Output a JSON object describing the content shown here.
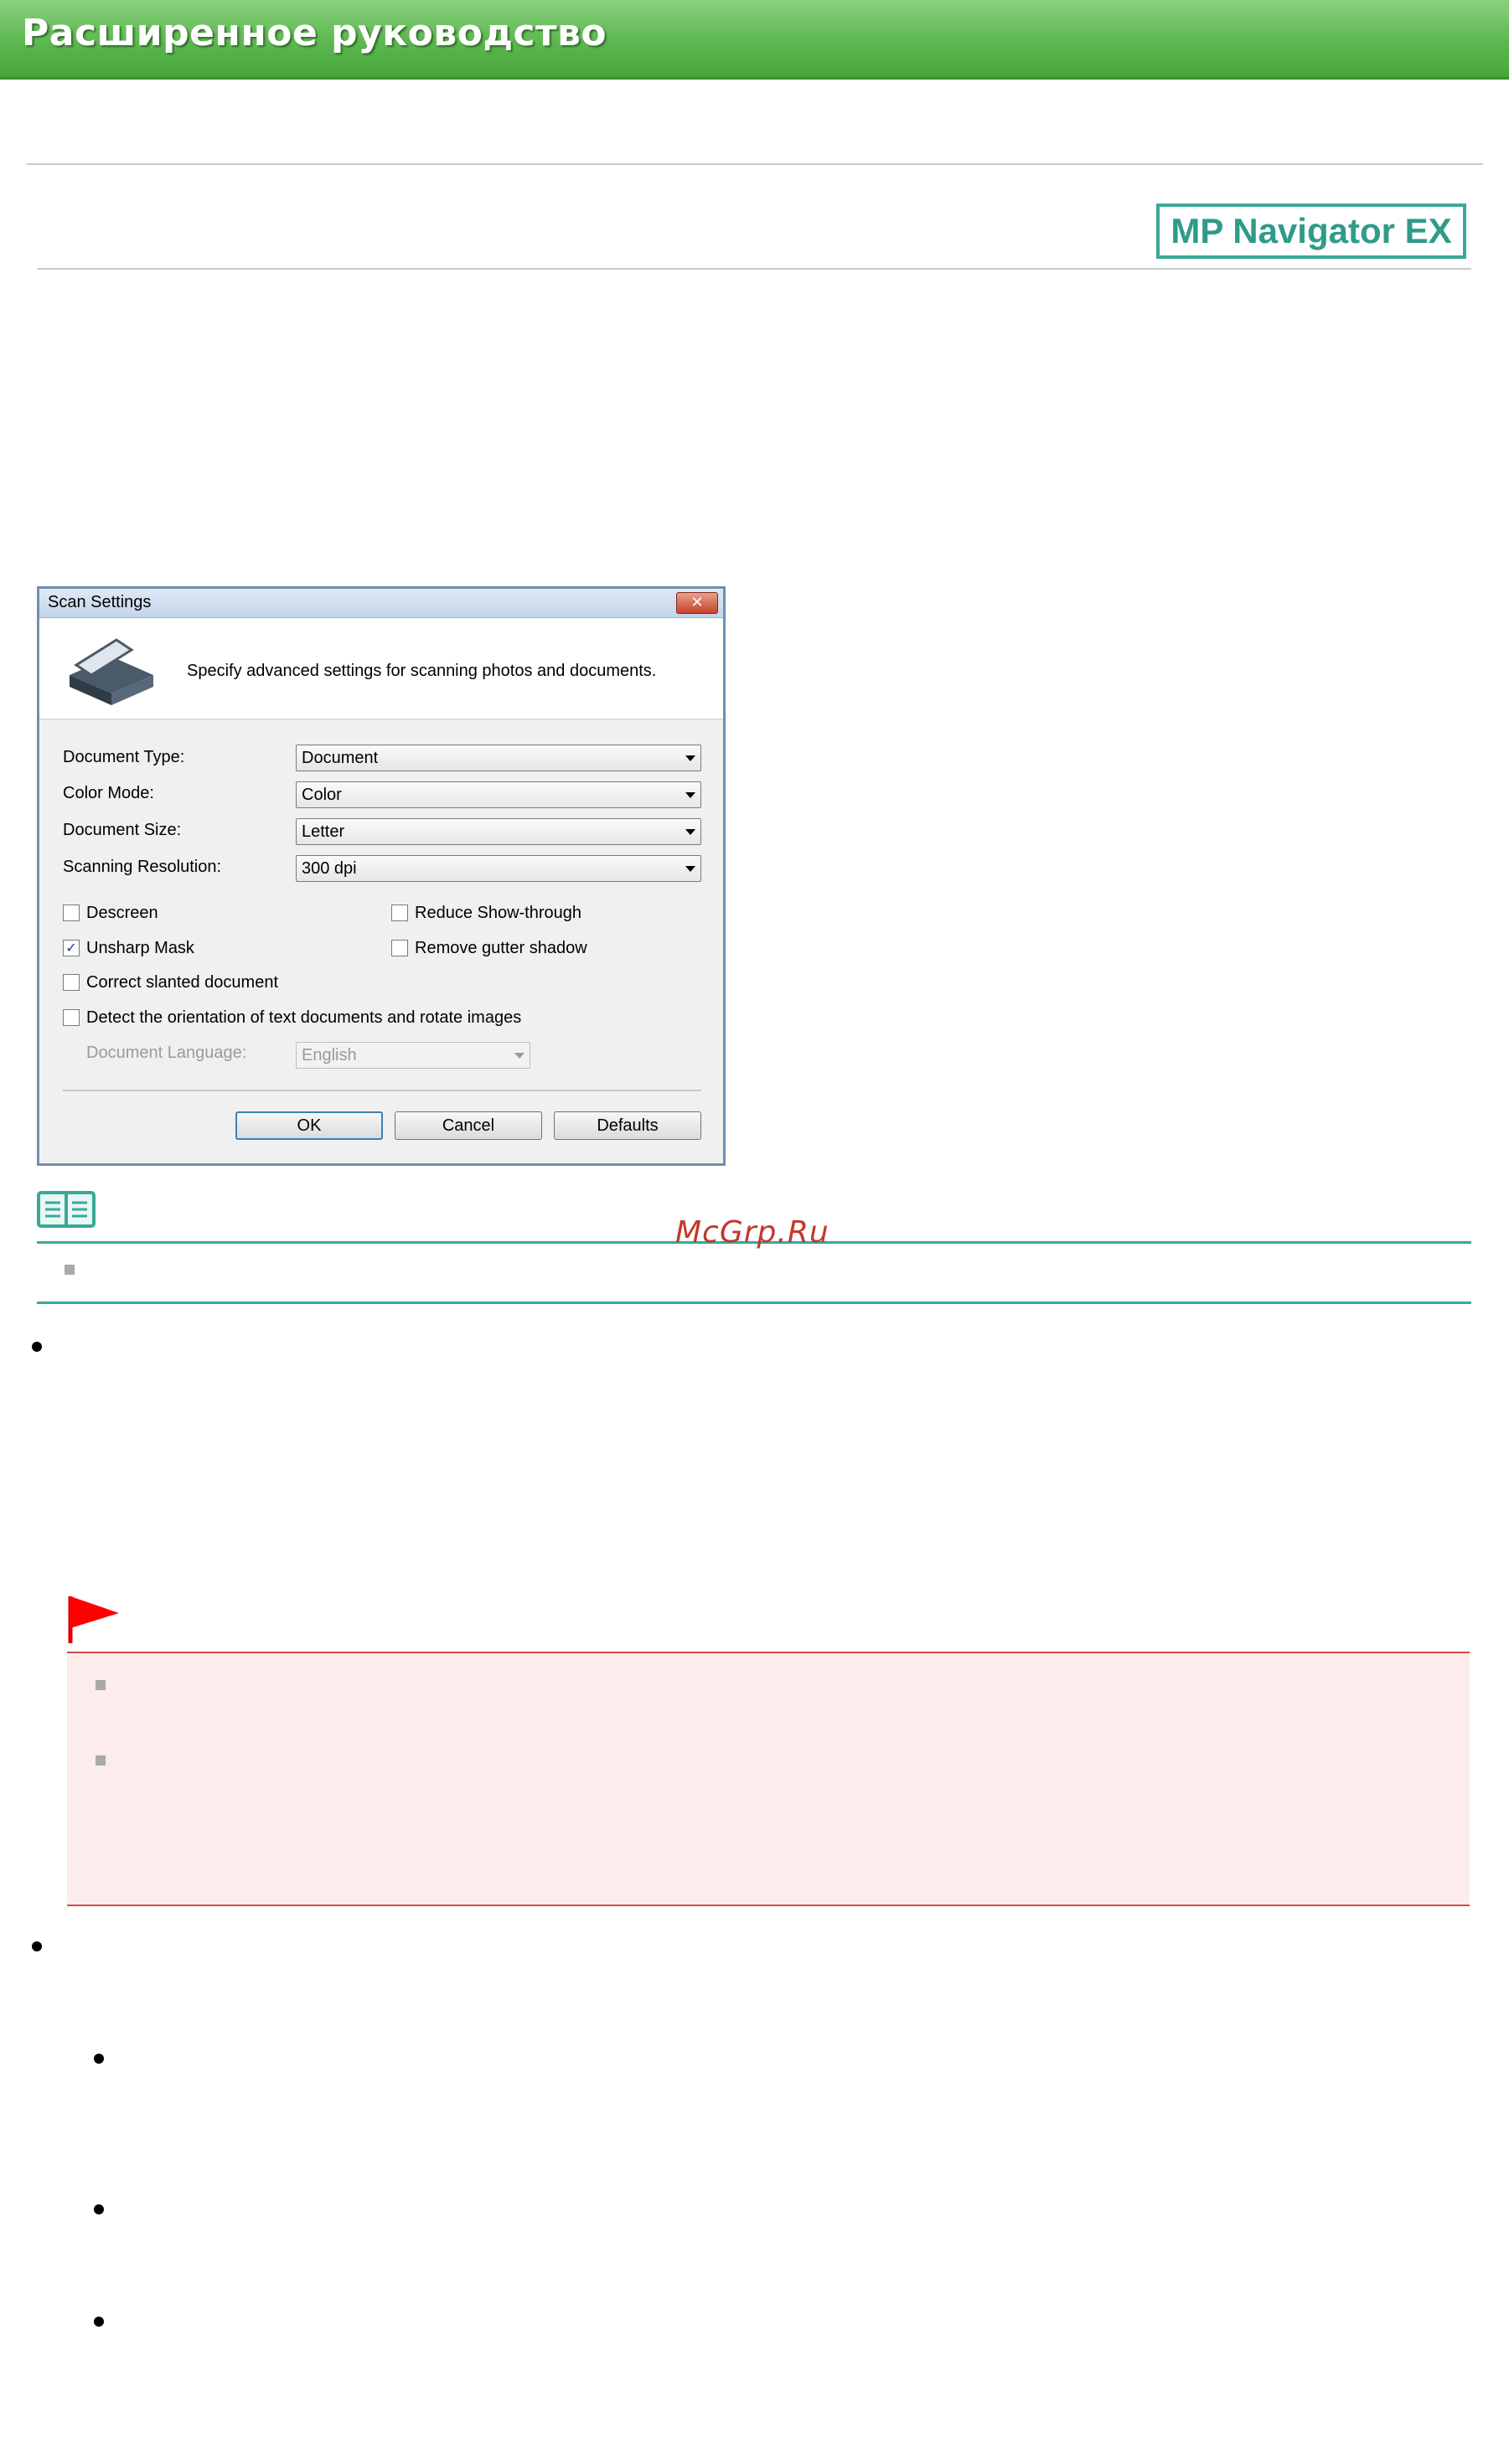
{
  "header": {
    "title": "Расширенное руководство"
  },
  "badge": {
    "label": "MP Navigator EX"
  },
  "dialog": {
    "title": "Scan Settings",
    "close_symbol": "✕",
    "description": "Specify advanced settings for scanning photos and documents.",
    "fields": [
      {
        "label": "Document Type:",
        "value": "Document"
      },
      {
        "label": "Color Mode:",
        "value": "Color"
      },
      {
        "label": "Document Size:",
        "value": "Letter"
      },
      {
        "label": "Scanning Resolution:",
        "value": "300 dpi"
      }
    ],
    "checkboxes": {
      "descreen": {
        "label": "Descreen",
        "checked": false
      },
      "reduce_show_through": {
        "label": "Reduce Show-through",
        "checked": false
      },
      "unsharp_mask": {
        "label": "Unsharp Mask",
        "checked": true,
        "mark": "✓"
      },
      "remove_gutter_shadow": {
        "label": "Remove gutter shadow",
        "checked": false
      },
      "correct_slanted": {
        "label": "Correct slanted document",
        "checked": false
      },
      "detect_orientation": {
        "label": "Detect the orientation of text documents and rotate images",
        "checked": false
      }
    },
    "language": {
      "label": "Document Language:",
      "value": "English"
    },
    "buttons": {
      "ok": "OK",
      "cancel": "Cancel",
      "defaults": "Defaults"
    }
  },
  "watermark": "McGrp.Ru",
  "colors": {
    "header_green": "#5cb84f",
    "teal": "#3aa898",
    "caution_red": "#d44a4a",
    "caution_bg": "#fcecec"
  }
}
